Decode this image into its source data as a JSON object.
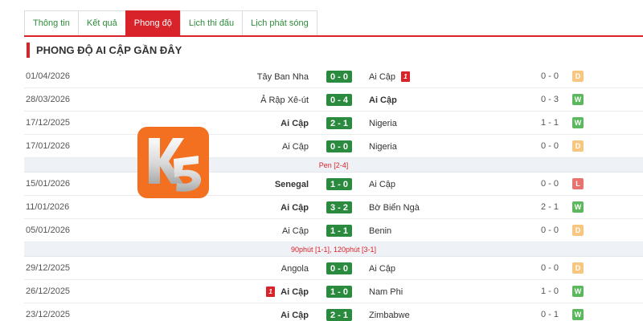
{
  "tabs": [
    {
      "label": "Thông tin",
      "active": false
    },
    {
      "label": "Kết quả",
      "active": false
    },
    {
      "label": "Phong độ",
      "active": true
    },
    {
      "label": "Lịch thi đấu",
      "active": false
    },
    {
      "label": "Lịch phát sóng",
      "active": false
    }
  ],
  "section_title": "PHONG ĐỘ AI CẬP GẦN ĐÂY",
  "matches": [
    {
      "kind": "match",
      "date": "01/04/2026",
      "home": "Tây Ban Nha",
      "home_bold": false,
      "score": "0 - 0",
      "away": "Ai Cập",
      "away_bold": false,
      "away_card": "1",
      "ht": "0 - 0",
      "result": "D"
    },
    {
      "kind": "match",
      "date": "28/03/2026",
      "home": "Ả Rập Xê-út",
      "home_bold": false,
      "score": "0 - 4",
      "away": "Ai Cập",
      "away_bold": true,
      "ht": "0 - 3",
      "result": "W"
    },
    {
      "kind": "match",
      "date": "17/12/2025",
      "home": "Ai Cập",
      "home_bold": true,
      "score": "2 - 1",
      "away": "Nigeria",
      "away_bold": false,
      "ht": "1 - 1",
      "result": "W"
    },
    {
      "kind": "match",
      "date": "17/01/2026",
      "home": "Ai Cập",
      "home_bold": false,
      "score": "0 - 0",
      "away": "Nigeria",
      "away_bold": false,
      "ht": "0 - 0",
      "result": "D"
    },
    {
      "kind": "note",
      "text": "Pen [2-4]"
    },
    {
      "kind": "match",
      "date": "15/01/2026",
      "home": "Senegal",
      "home_bold": true,
      "score": "1 - 0",
      "away": "Ai Cập",
      "away_bold": false,
      "ht": "0 - 0",
      "result": "L"
    },
    {
      "kind": "match",
      "date": "11/01/2026",
      "home": "Ai Cập",
      "home_bold": true,
      "score": "3 - 2",
      "away": "Bờ Biển Ngà",
      "away_bold": false,
      "ht": "2 - 1",
      "result": "W"
    },
    {
      "kind": "match",
      "date": "05/01/2026",
      "home": "Ai Cập",
      "home_bold": false,
      "score": "1 - 1",
      "away": "Benin",
      "away_bold": false,
      "ht": "0 - 0",
      "result": "D"
    },
    {
      "kind": "note",
      "text": "90phút [1-1], 120phút [3-1]"
    },
    {
      "kind": "match",
      "date": "29/12/2025",
      "home": "Angola",
      "home_bold": false,
      "score": "0 - 0",
      "away": "Ai Cập",
      "away_bold": false,
      "ht": "0 - 0",
      "result": "D"
    },
    {
      "kind": "match",
      "date": "26/12/2025",
      "home": "Ai Cập",
      "home_bold": true,
      "home_card": "1",
      "score": "1 - 0",
      "away": "Nam Phi",
      "away_bold": false,
      "ht": "1 - 0",
      "result": "W"
    },
    {
      "kind": "match",
      "date": "23/12/2025",
      "home": "Ai Cập",
      "home_bold": true,
      "score": "2 - 1",
      "away": "Zimbabwe",
      "away_bold": false,
      "ht": "0 - 1",
      "result": "W"
    }
  ],
  "colors": {
    "accent": "#d8232a",
    "score_bg": "#2a8a3e",
    "tab_text": "#2e8b3a",
    "logo_bg": "#f37021"
  }
}
